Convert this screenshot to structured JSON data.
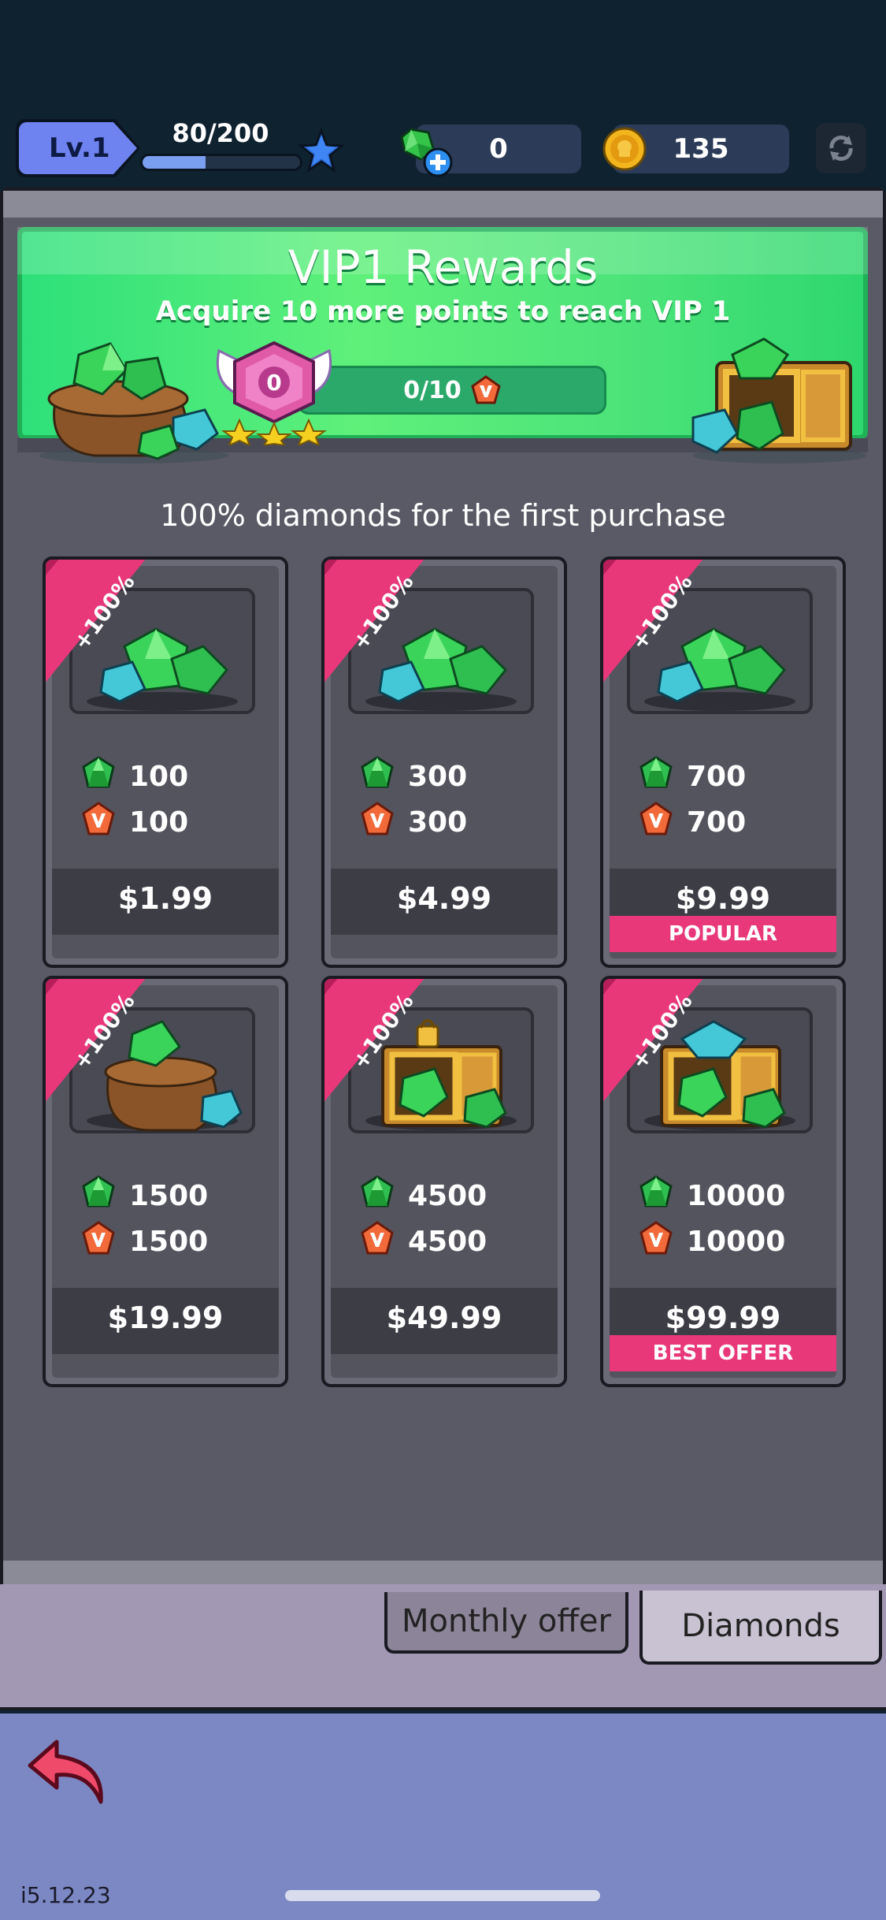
{
  "hud": {
    "level_label": "Lv.1",
    "xp_text": "80/200",
    "xp_progress": 0.4,
    "gems": "0",
    "coins": "135"
  },
  "vip": {
    "title": "VIP1 Rewards",
    "subtitle": "Acquire 10 more points to reach VIP 1",
    "progress_text": "0/10",
    "emblem_label": "0"
  },
  "promo_text": "100% diamonds for the first purchase",
  "ribbon_text": "+100%",
  "packs": [
    {
      "gems": "100",
      "vip": "100",
      "price": "$1.99",
      "tag": ""
    },
    {
      "gems": "300",
      "vip": "300",
      "price": "$4.99",
      "tag": ""
    },
    {
      "gems": "700",
      "vip": "700",
      "price": "$9.99",
      "tag": "POPULAR"
    },
    {
      "gems": "1500",
      "vip": "1500",
      "price": "$19.99",
      "tag": ""
    },
    {
      "gems": "4500",
      "vip": "4500",
      "price": "$49.99",
      "tag": ""
    },
    {
      "gems": "10000",
      "vip": "10000",
      "price": "$99.99",
      "tag": "BEST OFFER"
    }
  ],
  "tabs": {
    "monthly": "Monthly offer",
    "diamonds": "Diamonds"
  },
  "version": "i5.12.23",
  "colors": {
    "accent_pink": "#e8387a",
    "vip_green": "#4ee47a",
    "level_blue": "#6f83f0"
  }
}
